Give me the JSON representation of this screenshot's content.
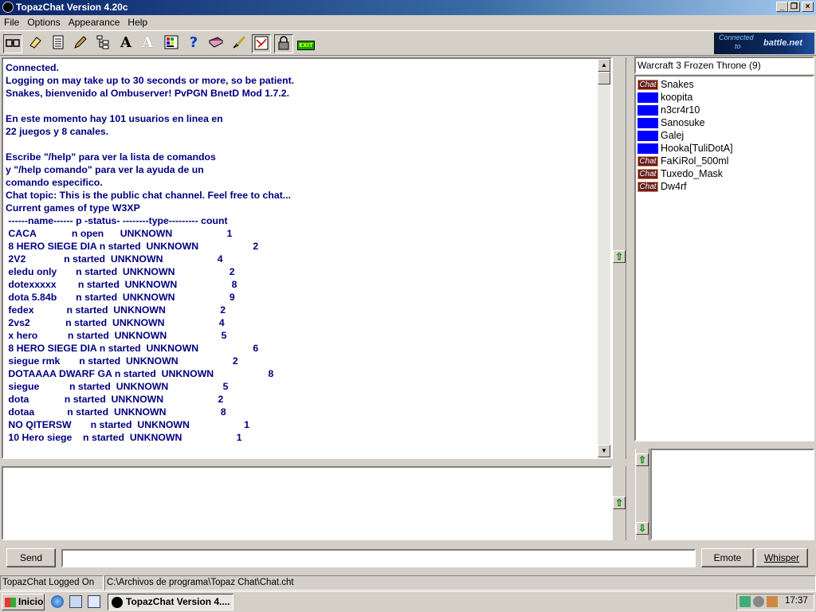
{
  "window": {
    "title": "TopazChat Version 4.20c"
  },
  "menu": [
    "File",
    "Options",
    "Appearance",
    "Help"
  ],
  "toolbar_icons": [
    "connect-icon",
    "eraser-icon",
    "list-icon",
    "pen-icon",
    "tree-icon",
    "font-icon",
    "font-gray-icon",
    "palette-icon",
    "help-icon",
    "book-icon",
    "brush-icon",
    "map-icon",
    "lock-icon",
    "exit-icon"
  ],
  "toolbar": {
    "exit_label": "EXIT"
  },
  "connected_logo": {
    "line1": "Connected",
    "line2": "to",
    "brand": "battle.net"
  },
  "chat": {
    "lines": [
      "Connected.",
      "Logging on may take up to 30 seconds or more, so be patient.",
      "Snakes, bienvenido al Ombuserver! PvPGN BnetD Mod 1.7.2.",
      "",
      "En este momento hay 101 usuarios en linea en",
      "22 juegos y 8 canales.",
      "",
      "Escribe \"/help\" para ver la lista de comandos",
      "y \"/help comando\" para ver la ayuda de un",
      "comando especifico.",
      "Chat topic: This is the public chat channel. Feel free to chat...",
      "Current games of type W3XP",
      " ------name------ p -status- --------type--------- count",
      " CACA             n open      UNKNOWN                    1",
      " 8 HERO SIEGE DIA n started  UNKNOWN                    2",
      " 2V2              n started  UNKNOWN                    4",
      " eledu only       n started  UNKNOWN                    2",
      " dotexxxxx        n started  UNKNOWN                    8",
      " dota 5.84b       n started  UNKNOWN                    9",
      " fedex            n started  UNKNOWN                    2",
      " 2vs2             n started  UNKNOWN                    4",
      " x hero           n started  UNKNOWN                    5",
      " 8 HERO SIEGE DIA n started  UNKNOWN                    6",
      " siegue rmk       n started  UNKNOWN                    2",
      " DOTAAAA DWARF GA n started  UNKNOWN                    8",
      " siegue           n started  UNKNOWN                    5",
      " dota             n started  UNKNOWN                    2",
      " dotaa            n started  UNKNOWN                    8",
      " NO QITERSW       n started  UNKNOWN                    1",
      " 10 Hero siege    n started  UNKNOWN                    1"
    ]
  },
  "channel": {
    "name": "Warcraft 3 Frozen Throne (9)"
  },
  "users": [
    {
      "name": "Snakes",
      "badge": "Chat"
    },
    {
      "name": "koopita",
      "badge": ""
    },
    {
      "name": "n3cr4r10",
      "badge": ""
    },
    {
      "name": "Sanosuke",
      "badge": ""
    },
    {
      "name": "Galej",
      "badge": ""
    },
    {
      "name": "Hooka[TuliDotA]",
      "badge": ""
    },
    {
      "name": "FaKiRol_500ml",
      "badge": "Chat"
    },
    {
      "name": "Tuxedo_Mask",
      "badge": "Chat"
    },
    {
      "name": "Dw4rf",
      "badge": "Chat"
    }
  ],
  "buttons": {
    "send": "Send",
    "emote": "Emote",
    "whisper": "Whisper"
  },
  "input": {
    "value": ""
  },
  "status": {
    "left": "TopazChat Logged On",
    "right": "C:\\Archivos de programa\\Topaz Chat\\Chat.cht"
  },
  "taskbar": {
    "start": "Inicio",
    "task": "TopazChat Version 4....",
    "clock": "17:37"
  },
  "colors": {
    "title_start": "#0a246a",
    "chat_text": "#000080",
    "chat_badge": "#6b1f1f",
    "user_badge_blue": "#0000ff"
  }
}
